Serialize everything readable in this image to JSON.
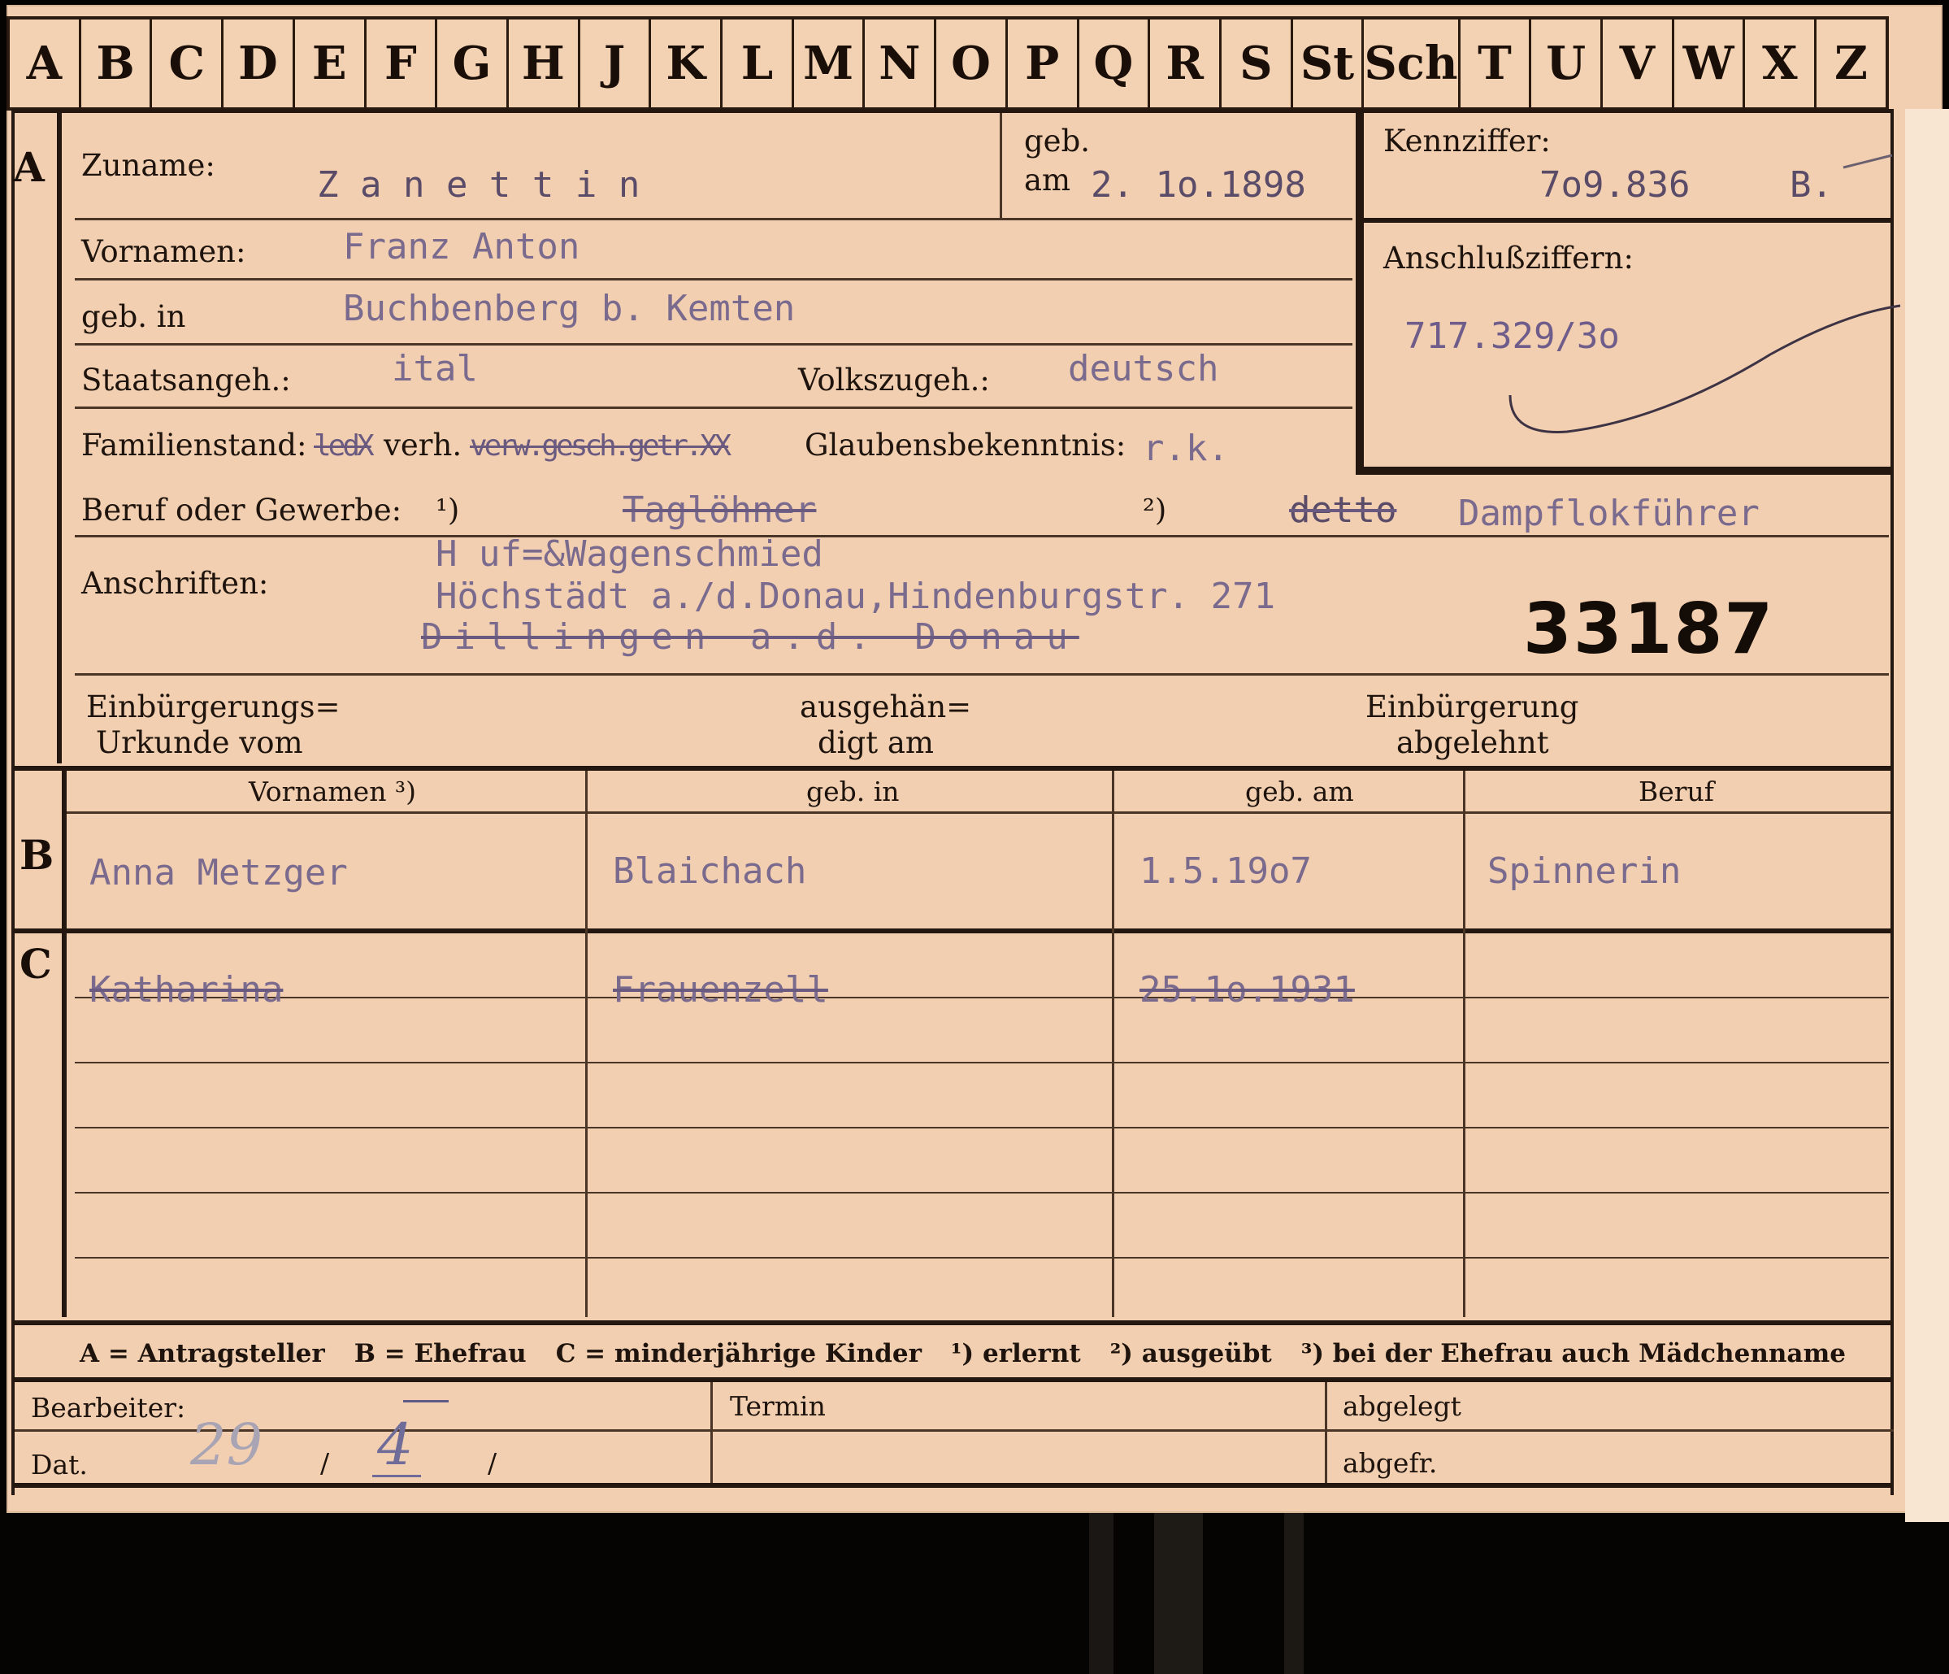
{
  "tabs": [
    "A",
    "B",
    "C",
    "D",
    "E",
    "F",
    "G",
    "H",
    "J",
    "K",
    "L",
    "M",
    "N",
    "O",
    "P",
    "Q",
    "R",
    "S",
    "St",
    "Sch",
    "T",
    "U",
    "V",
    "W",
    "X",
    "Z"
  ],
  "section_letters": {
    "a": "A",
    "b": "B",
    "c": "C"
  },
  "labels": {
    "zuname": "Zuname:",
    "geb_am": "geb.",
    "am": "am",
    "vornamen": "Vornamen:",
    "geb_in": "geb. in",
    "staatsangeh": "Staatsangeh.:",
    "volkszugeh": "Volkszugeh.:",
    "familienstand": "Familienstand:",
    "verh": "verh.",
    "glaubensbekenntnis": "Glaubensbekenntnis:",
    "beruf": "Beruf oder Gewerbe:",
    "fn1": "¹)",
    "fn2": "²)",
    "anschriften": "Anschriften:",
    "einbuergerung_urkunde_1": "Einbürgerungs=",
    "einbuergerung_urkunde_2": "Urkunde vom",
    "ausgehaendigt_1": "ausgehän=",
    "ausgehaendigt_2": "digt am",
    "abgelehnt_1": "Einbürgerung",
    "abgelehnt_2": "abgelehnt",
    "kennziffer": "Kennziffer:",
    "anschlussziffern": "Anschlußziffern:"
  },
  "person": {
    "zuname": "Z a n e t t i n",
    "geb_am": "2. 1o.1898",
    "vornamen": "Franz  Anton",
    "geb_in": "Buchbenberg  b.  Kemten",
    "staatsangeh": "ital",
    "volkszugeh": "deutsch",
    "familienstand_struck_1": "ledX",
    "familienstand_struck_2": "verw.gesch.getr.XX",
    "glaubensbekenntnis": "r.k.",
    "beruf_erlernt": "Taglöhner",
    "beruf_ausgeuebt_struck": "detto",
    "beruf_ausgeuebt": "Dampflokführer",
    "anschrift_1": "H uf=&Wagenschmied",
    "anschrift_2": "Höchstädt a./d.Donau,Hindenburgstr. 271",
    "anschrift_3": "Dillingen a.d. Donau"
  },
  "kennziffer": {
    "value": "7o9.836",
    "suffix": "B."
  },
  "anschlussziffer": "717.329/3o",
  "card_number": "33187",
  "table_headers": {
    "vornamen": "Vornamen ³)",
    "geb_in": "geb. in",
    "geb_am": "geb. am",
    "beruf": "Beruf"
  },
  "ehefrau": {
    "vornamen": "Anna Metzger",
    "geb_in": "Blaichach",
    "geb_am": "1.5.19o7",
    "beruf": "Spinnerin"
  },
  "kinder": [
    {
      "vornamen": "Katharina",
      "geb_in": "Frauenzell",
      "geb_am": "25.1o.1931",
      "beruf": ""
    }
  ],
  "legend": [
    "A = Antragsteller",
    "B = Ehefrau",
    "C = minderjährige Kinder",
    "¹) erlernt",
    "²) ausgeübt",
    "³) bei der Ehefrau auch Mädchenname"
  ],
  "footer": {
    "bearbeiter": "Bearbeiter:",
    "dat": "Dat.",
    "termin": "Termin",
    "abgelegt": "abgelegt",
    "abgefr": "abgefr.",
    "handwritten_day": "29",
    "handwritten_month": "4"
  }
}
